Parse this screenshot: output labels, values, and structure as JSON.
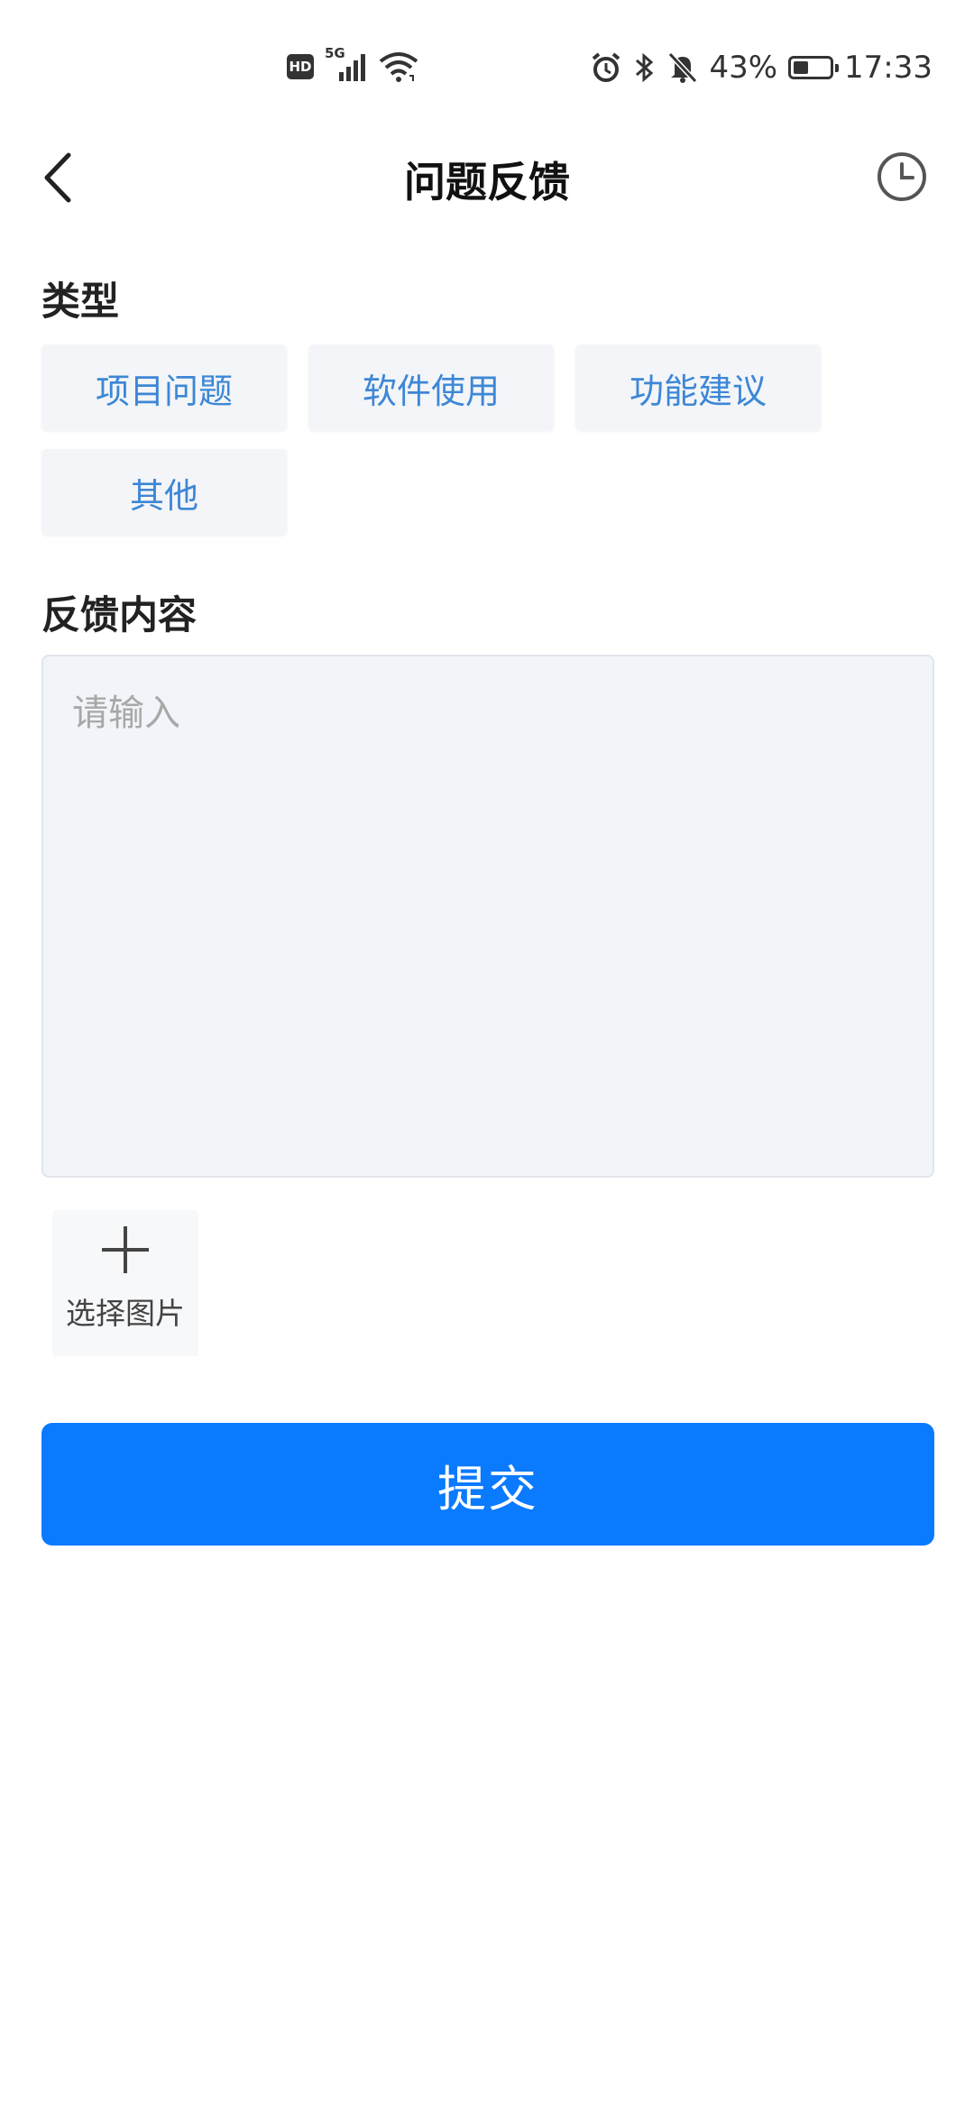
{
  "status_bar": {
    "hd": "HD",
    "network": "5G",
    "battery_percent": "43%",
    "battery_level": 0.43,
    "time": "17:33",
    "icons": [
      "signal-icon",
      "wifi-icon",
      "alarm-icon",
      "bluetooth-icon",
      "mute-icon",
      "battery-icon"
    ]
  },
  "header": {
    "title": "问题反馈",
    "back_icon": "back-arrow-icon",
    "history_icon": "clock-icon"
  },
  "type_section": {
    "label": "类型",
    "options": [
      {
        "label": "项目问题"
      },
      {
        "label": "软件使用"
      },
      {
        "label": "功能建议"
      },
      {
        "label": "其他"
      }
    ]
  },
  "content_section": {
    "label": "反馈内容",
    "value": "",
    "placeholder": "请输入"
  },
  "image_picker": {
    "label": "选择图片",
    "icon": "plus-icon"
  },
  "submit": {
    "label": "提交"
  },
  "colors": {
    "accent": "#0a7aff",
    "chip_text": "#3d87d6",
    "chip_bg": "#f3f5f8",
    "input_bg": "#f1f4f8"
  }
}
